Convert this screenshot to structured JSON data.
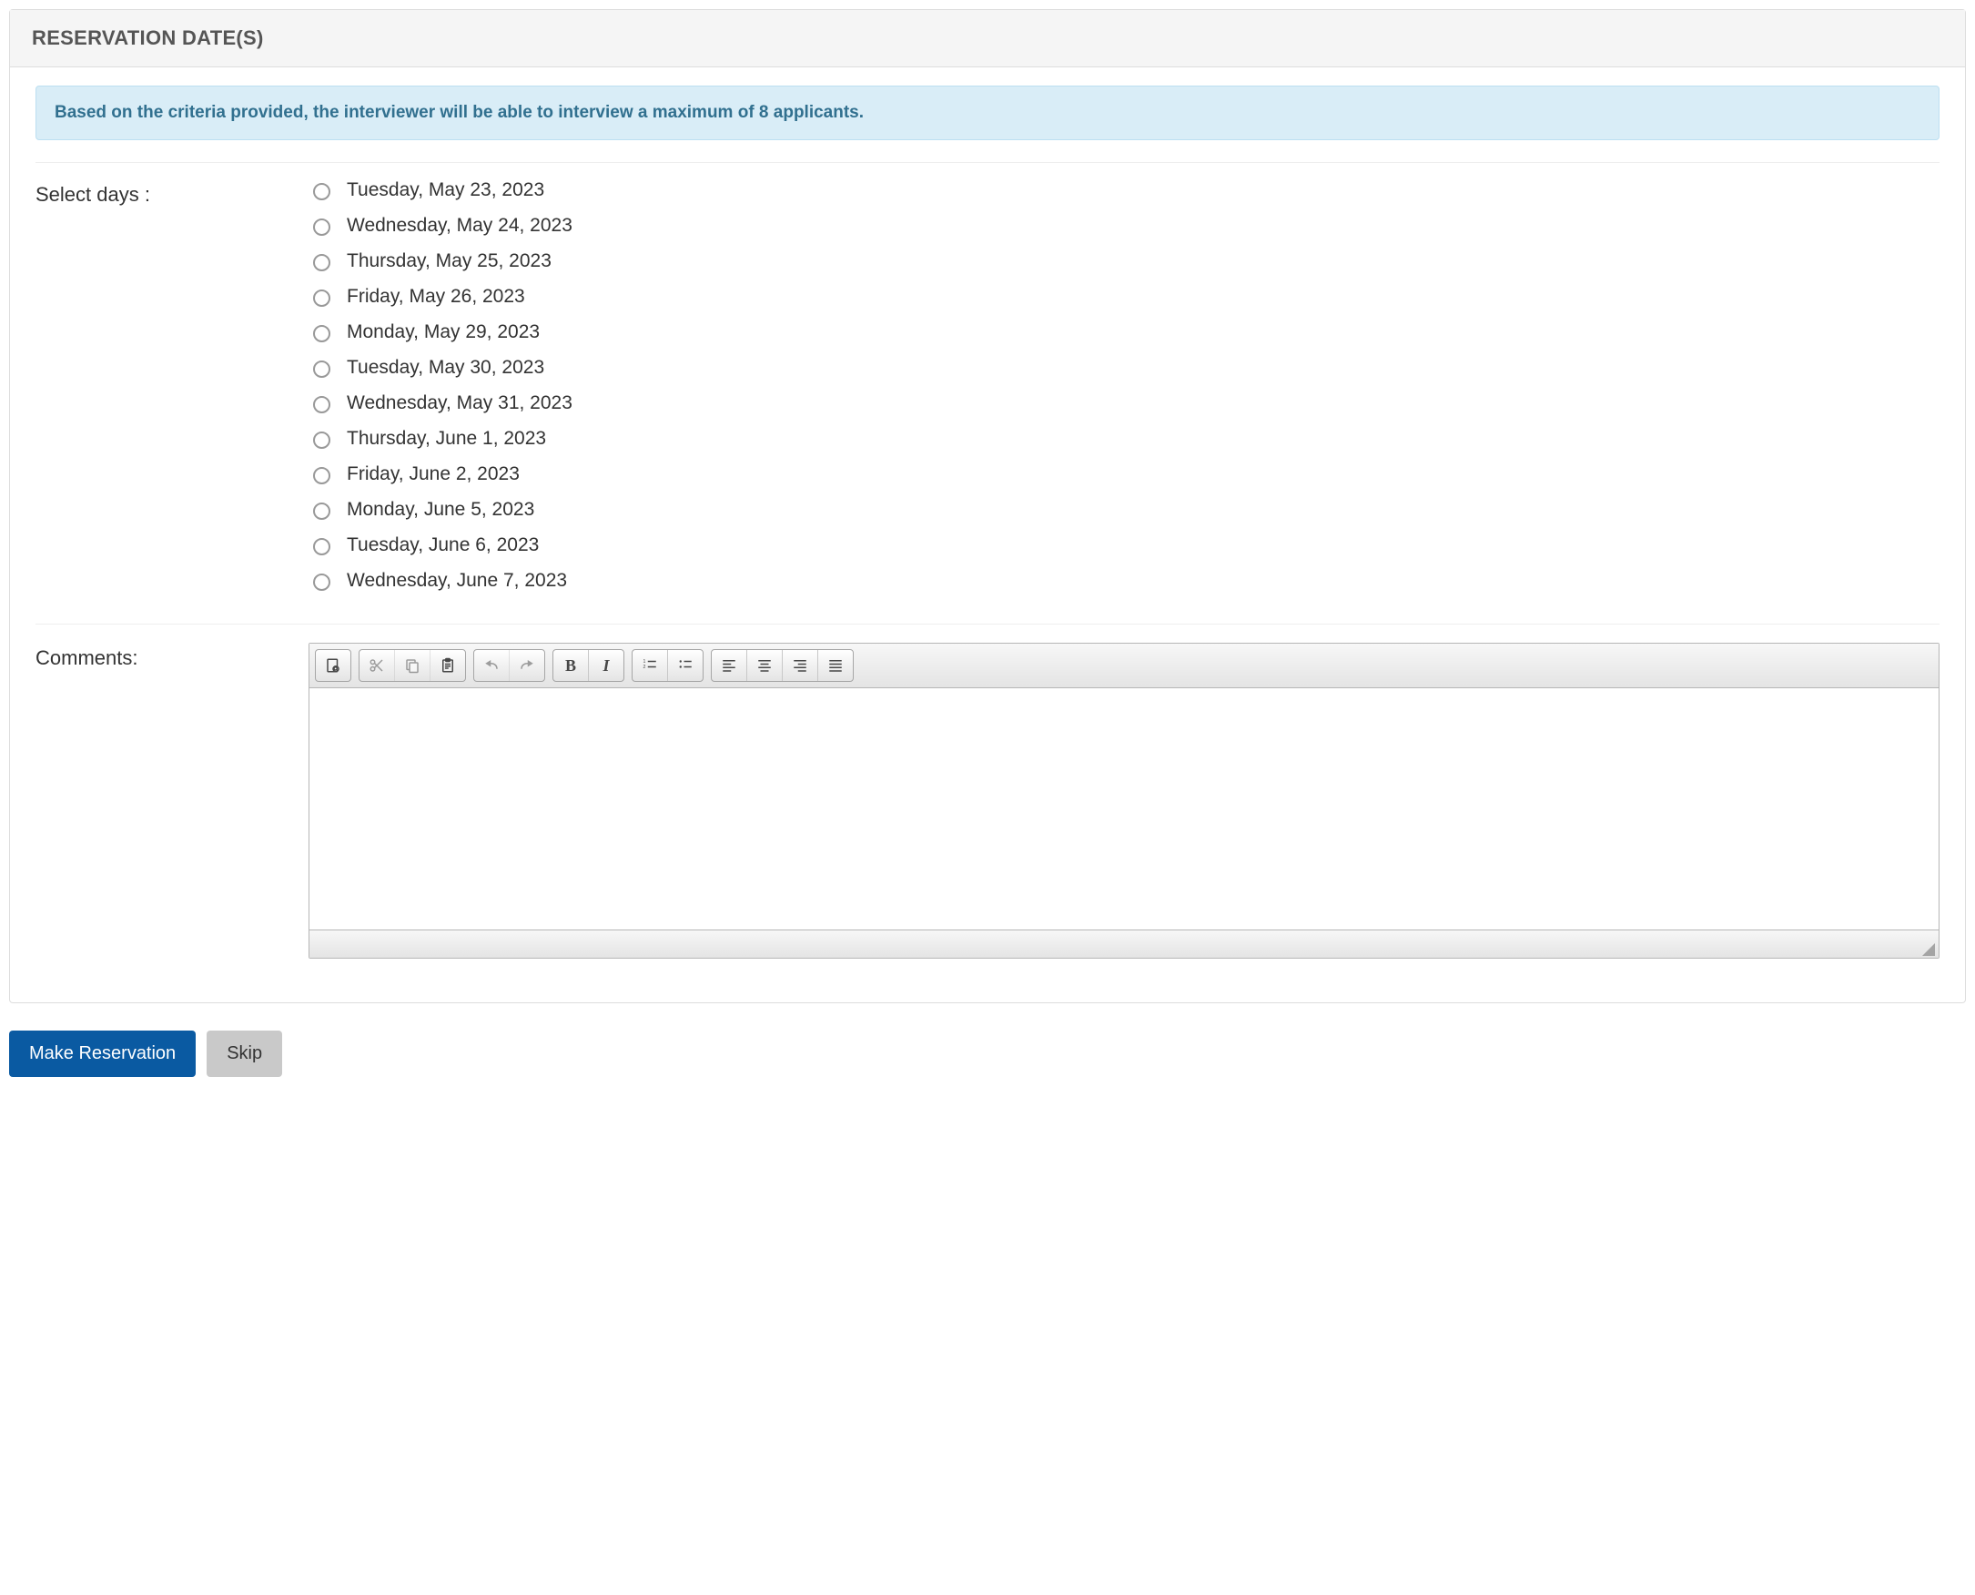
{
  "panel": {
    "title": "RESERVATION DATE(S)",
    "alert": "Based on the criteria provided, the interviewer will be able to interview a maximum of 8 applicants."
  },
  "labels": {
    "select_days": "Select days :",
    "comments": "Comments:"
  },
  "days": [
    "Tuesday, May 23, 2023",
    "Wednesday, May 24, 2023",
    "Thursday, May 25, 2023",
    "Friday, May 26, 2023",
    "Monday, May 29, 2023",
    "Tuesday, May 30, 2023",
    "Wednesday, May 31, 2023",
    "Thursday, June 1, 2023",
    "Friday, June 2, 2023",
    "Monday, June 5, 2023",
    "Tuesday, June 6, 2023",
    "Wednesday, June 7, 2023"
  ],
  "editor": {
    "content": ""
  },
  "buttons": {
    "make_reservation": "Make Reservation",
    "skip": "Skip"
  }
}
